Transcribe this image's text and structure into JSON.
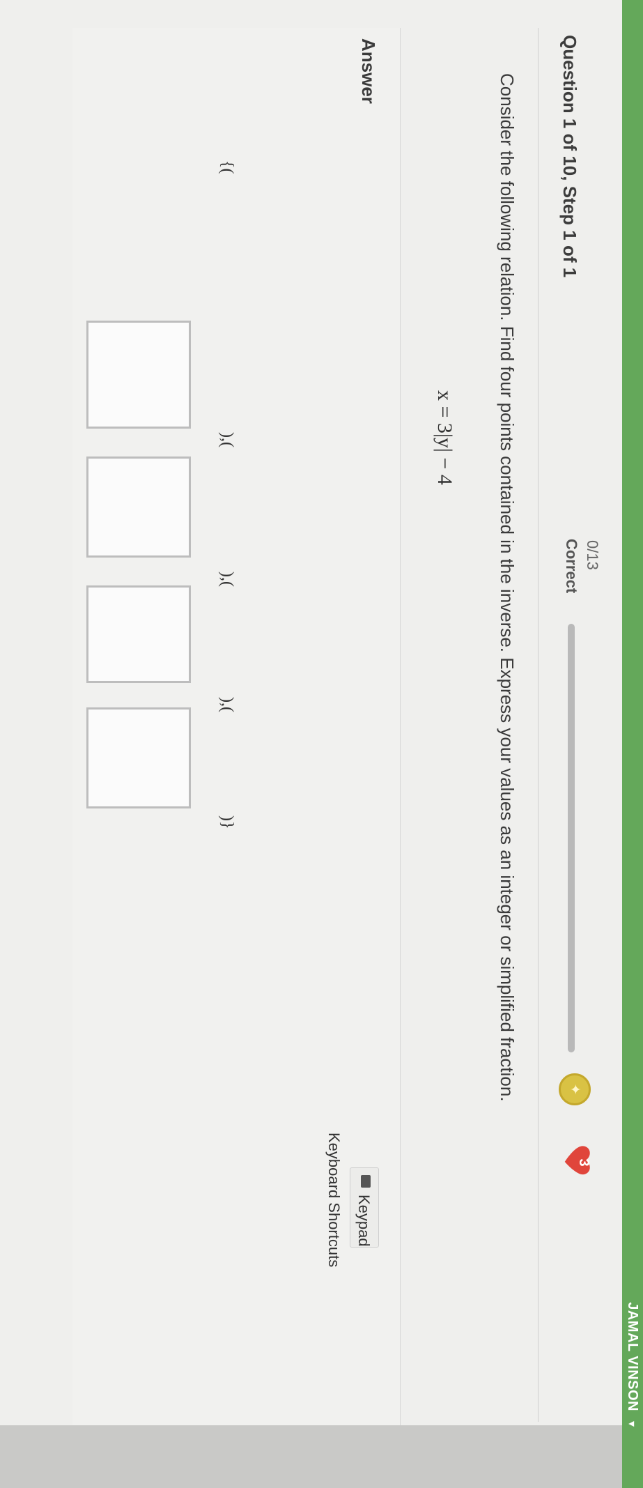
{
  "header": {
    "username": "JAMAL VINSON"
  },
  "question": {
    "header": "Question 1 of 10, Step 1 of 1",
    "score": "0/13",
    "score_label": "Correct",
    "progress": 0,
    "hearts": "3"
  },
  "instructions": "Consider the following relation. Find four points contained in the inverse. Express your values as an integer or simplified fraction.",
  "equation": "x = 3|y| − 4",
  "answer": {
    "label": "Answer",
    "open": "{(",
    "sep1": "),(",
    "sep2": "),(",
    "sep3": "),(",
    "close": ")}",
    "values": [
      "",
      "",
      "",
      ""
    ]
  },
  "tools": {
    "keypad": "Keypad",
    "shortcuts": "Keyboard Shortcuts"
  },
  "colors": {
    "brand_green": "#64a85a",
    "heart_red": "#e0453b",
    "coin_gold": "#d9c244"
  }
}
